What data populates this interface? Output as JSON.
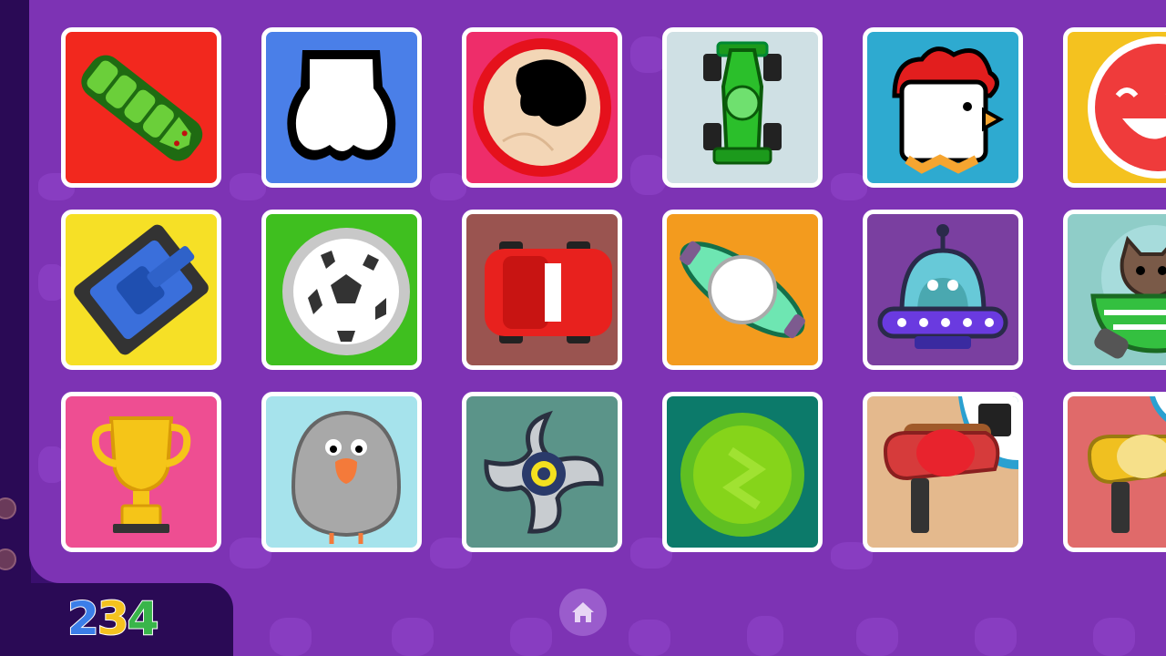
{
  "player_count": {
    "digits": [
      "2",
      "3",
      "4"
    ],
    "colors": [
      "#3b7ee8",
      "#f4c21f",
      "#39b54a"
    ]
  },
  "nav": {
    "home_icon": "home-icon"
  },
  "colors": {
    "panel": "#7d33b4",
    "background": "#3a0f6e",
    "tile_border": "#ffffff"
  },
  "games": [
    {
      "name": "snake",
      "icon": "snake-icon",
      "bg": "#f2281e"
    },
    {
      "name": "paw",
      "icon": "paw-icon",
      "bg": "#4a7fe8"
    },
    {
      "name": "sumo",
      "icon": "sumo-icon",
      "bg": "#ee2d6a"
    },
    {
      "name": "race-car",
      "icon": "race-car-icon",
      "bg": "#cfe0e4"
    },
    {
      "name": "chicken",
      "icon": "chicken-icon",
      "bg": "#2eaad0"
    },
    {
      "name": "smiley",
      "icon": "smiley-icon",
      "bg": "#f4c21f"
    },
    {
      "name": "tank",
      "icon": "tank-icon",
      "bg": "#f6e026"
    },
    {
      "name": "soccer",
      "icon": "soccer-ball-icon",
      "bg": "#3fbf1f"
    },
    {
      "name": "car",
      "icon": "red-car-icon",
      "bg": "#9a5450"
    },
    {
      "name": "spaceship",
      "icon": "spaceship-icon",
      "bg": "#f39b1e"
    },
    {
      "name": "ufo",
      "icon": "ufo-icon",
      "bg": "#7a3fa0"
    },
    {
      "name": "cat-boat",
      "icon": "cat-icon",
      "bg": "#8fcdc8"
    },
    {
      "name": "trophy",
      "icon": "trophy-icon",
      "bg": "#ee4e92"
    },
    {
      "name": "pigeon",
      "icon": "pigeon-icon",
      "bg": "#a6e3ec"
    },
    {
      "name": "shuriken",
      "icon": "shuriken-icon",
      "bg": "#5b9489"
    },
    {
      "name": "green-ball",
      "icon": "green-ball-icon",
      "bg": "#0c7a6a"
    },
    {
      "name": "red-boxer",
      "icon": "boxer-red-icon",
      "bg": "#e4b98d"
    },
    {
      "name": "yellow-boxer",
      "icon": "boxer-yellow-icon",
      "bg": "#e06a6a"
    }
  ]
}
